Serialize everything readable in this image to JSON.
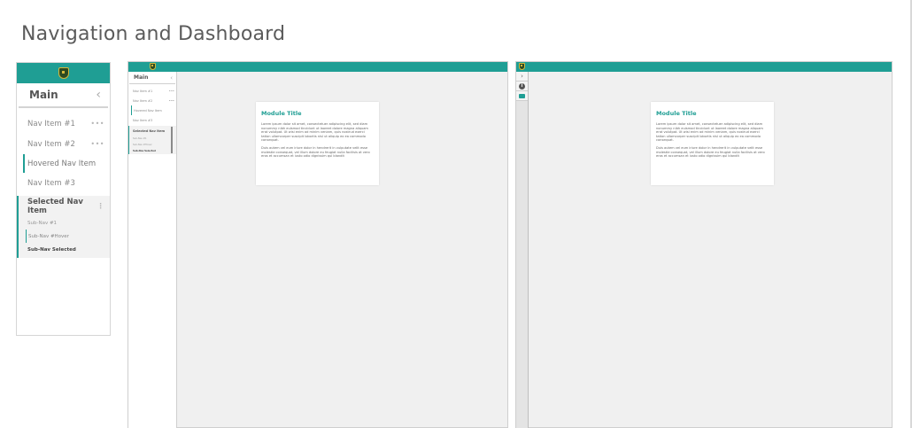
{
  "page_title": "Navigation and Dashboard",
  "nav": {
    "header": "Main",
    "items": [
      {
        "label": "Nav Item #1"
      },
      {
        "label": "Nav Item #2"
      },
      {
        "label": "Hovered Nav Item"
      },
      {
        "label": "Nav Item #3"
      }
    ],
    "selected": {
      "label": "Selected Nav Item",
      "sub_items": [
        "Sub-Nav #1",
        "Sub-Nav #Hover",
        "Sub-Nav Selected"
      ]
    }
  },
  "module": {
    "title": "Module Title",
    "paragraph1": "Lorem ipsum dolor sit amet, consectetuer adipiscing elit, sed diam nonummy nibh euismod tincidunt ut laoreet dolore magna aliquam erat volutpat. Ut wisi enim ad minim veniam, quis nostrud exerci tation ullamcorper suscipit lobortis nisl ut aliquip ex ea commodo consequat.",
    "paragraph2": "Duis autem vel eum iriure dolor in hendrerit in vulputate velit esse molestie consequat, vel illum dolore eu feugiat nulla facilisis at vero eros et accumsan et iusto odio dignissim qui blandit"
  },
  "icons": {
    "collapse": "chevron-left-icon",
    "expand": "chevron-right-icon",
    "more": "more-dots-icon",
    "info": "info-icon",
    "folder": "folder-icon",
    "logo": "shield-logo-icon"
  },
  "colors": {
    "accent": "#1f9e94",
    "text": "#555555",
    "muted": "#8a8a8a",
    "canvas": "#f0f0f0"
  }
}
